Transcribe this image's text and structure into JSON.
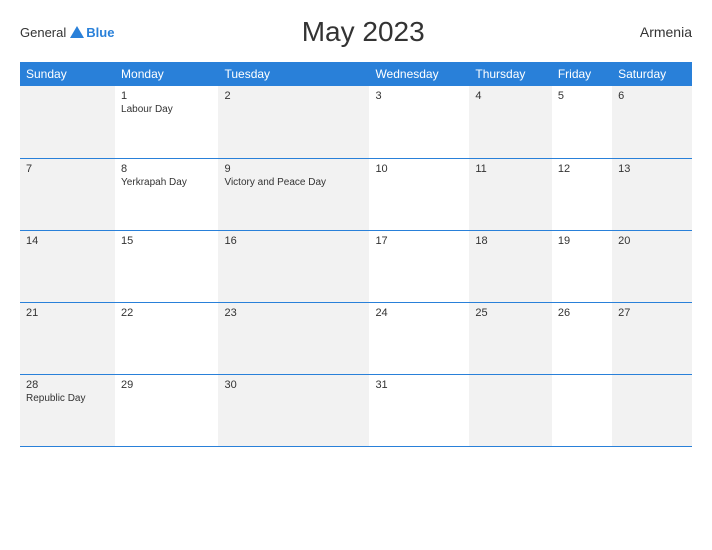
{
  "header": {
    "logo_general": "General",
    "logo_blue": "Blue",
    "title": "May 2023",
    "country": "Armenia"
  },
  "weekdays": [
    "Sunday",
    "Monday",
    "Tuesday",
    "Wednesday",
    "Thursday",
    "Friday",
    "Saturday"
  ],
  "weeks": [
    [
      {
        "day": "",
        "holiday": "",
        "gray": true
      },
      {
        "day": "1",
        "holiday": "Labour Day",
        "gray": false
      },
      {
        "day": "2",
        "holiday": "",
        "gray": true
      },
      {
        "day": "3",
        "holiday": "",
        "gray": false
      },
      {
        "day": "4",
        "holiday": "",
        "gray": true
      },
      {
        "day": "5",
        "holiday": "",
        "gray": false
      },
      {
        "day": "6",
        "holiday": "",
        "gray": true
      }
    ],
    [
      {
        "day": "7",
        "holiday": "",
        "gray": true
      },
      {
        "day": "8",
        "holiday": "Yerkrapah Day",
        "gray": false
      },
      {
        "day": "9",
        "holiday": "Victory and Peace Day",
        "gray": true
      },
      {
        "day": "10",
        "holiday": "",
        "gray": false
      },
      {
        "day": "11",
        "holiday": "",
        "gray": true
      },
      {
        "day": "12",
        "holiday": "",
        "gray": false
      },
      {
        "day": "13",
        "holiday": "",
        "gray": true
      }
    ],
    [
      {
        "day": "14",
        "holiday": "",
        "gray": true
      },
      {
        "day": "15",
        "holiday": "",
        "gray": false
      },
      {
        "day": "16",
        "holiday": "",
        "gray": true
      },
      {
        "day": "17",
        "holiday": "",
        "gray": false
      },
      {
        "day": "18",
        "holiday": "",
        "gray": true
      },
      {
        "day": "19",
        "holiday": "",
        "gray": false
      },
      {
        "day": "20",
        "holiday": "",
        "gray": true
      }
    ],
    [
      {
        "day": "21",
        "holiday": "",
        "gray": true
      },
      {
        "day": "22",
        "holiday": "",
        "gray": false
      },
      {
        "day": "23",
        "holiday": "",
        "gray": true
      },
      {
        "day": "24",
        "holiday": "",
        "gray": false
      },
      {
        "day": "25",
        "holiday": "",
        "gray": true
      },
      {
        "day": "26",
        "holiday": "",
        "gray": false
      },
      {
        "day": "27",
        "holiday": "",
        "gray": true
      }
    ],
    [
      {
        "day": "28",
        "holiday": "Republic Day",
        "gray": true
      },
      {
        "day": "29",
        "holiday": "",
        "gray": false
      },
      {
        "day": "30",
        "holiday": "",
        "gray": true
      },
      {
        "day": "31",
        "holiday": "",
        "gray": false
      },
      {
        "day": "",
        "holiday": "",
        "gray": true
      },
      {
        "day": "",
        "holiday": "",
        "gray": false
      },
      {
        "day": "",
        "holiday": "",
        "gray": true
      }
    ]
  ]
}
